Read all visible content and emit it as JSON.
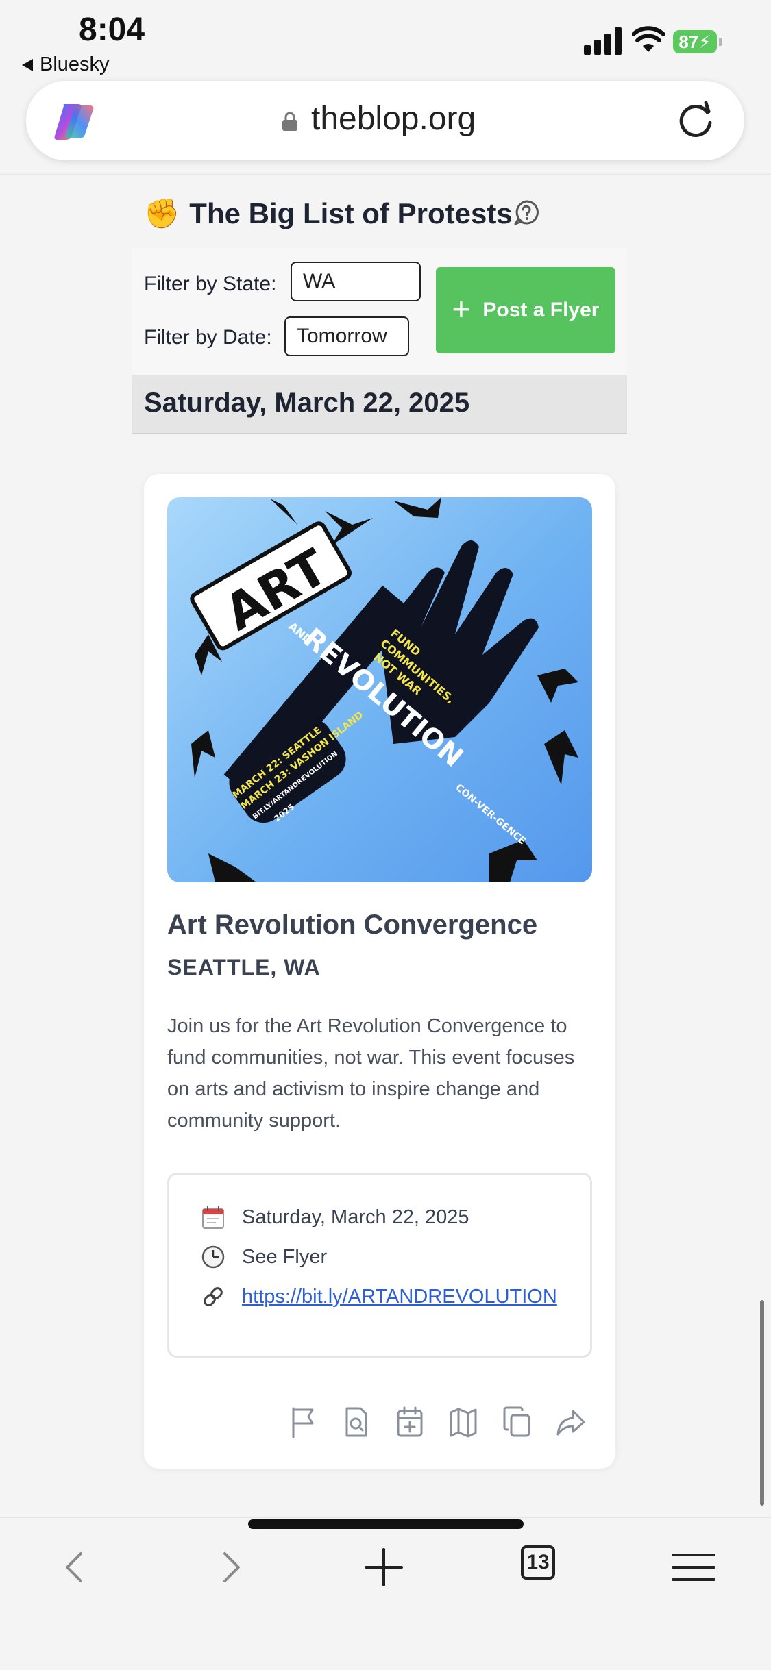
{
  "status": {
    "time": "8:04",
    "back_app": "Bluesky",
    "battery": "87"
  },
  "browser": {
    "url": "theblop.org",
    "tab_count": "13"
  },
  "page": {
    "title": "The Big List of Protests",
    "filter_state_label": "Filter by State:",
    "filter_state_value": "WA",
    "filter_date_label": "Filter by Date:",
    "filter_date_value": "Tomorrow",
    "post_button": "Post a Flyer",
    "date_header": "Saturday, March 22, 2025"
  },
  "event": {
    "title": "Art Revolution Convergence",
    "location": "SEATTLE, WA",
    "description": "Join us for the Art Revolution Convergence to fund communities, not war. This event focuses on arts and activism to inspire change and community support.",
    "date": "Saturday, March 22, 2025",
    "time": "See Flyer",
    "link": "https://bit.ly/ARTANDREVOLUTION",
    "flyer_text": {
      "art": "ART",
      "and": "AND",
      "revolution": "REVOLUTION",
      "convergence": "CON-VER-GENCE",
      "slogan_1": "FUND",
      "slogan_2": "COMMUNITIES,",
      "slogan_3": "NOT WAR",
      "handle_1": "MARCH 22: SEATTLE",
      "handle_2": "MARCH 23: VASHON ISLAND",
      "handle_3": "BIT.LY/ARTANDREVOLUTION",
      "handle_4": "2025"
    }
  },
  "icons": {
    "actions": [
      "flag-icon",
      "search-document-icon",
      "calendar-add-icon",
      "map-icon",
      "copy-icon",
      "share-icon"
    ]
  },
  "colors": {
    "post_button": "#56c35e",
    "link": "#2a5fd8",
    "battery": "#5cc95f"
  }
}
